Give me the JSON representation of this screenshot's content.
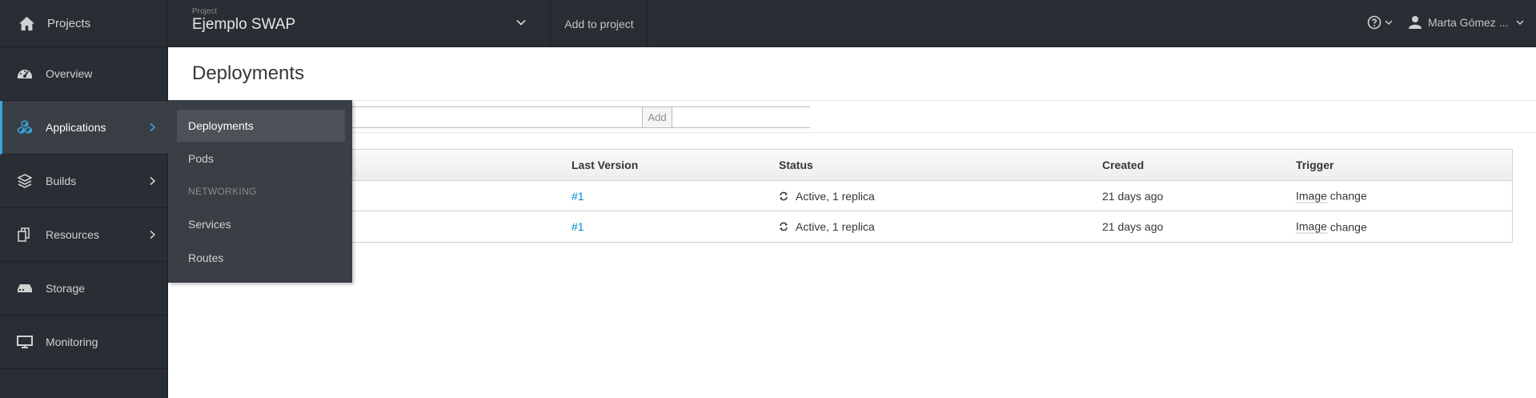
{
  "topbar": {
    "brand_label": "Projects",
    "project_caption": "Project",
    "project_name": "Ejemplo SWAP",
    "add_to_project": "Add to project",
    "user_name": "Marta Gómez ..."
  },
  "sidebar": {
    "items": [
      {
        "label": "Overview",
        "icon": "dashboard-icon"
      },
      {
        "label": "Applications",
        "icon": "cubes-icon",
        "active": true
      },
      {
        "label": "Builds",
        "icon": "layers-icon"
      },
      {
        "label": "Resources",
        "icon": "resources-icon"
      },
      {
        "label": "Storage",
        "icon": "storage-icon"
      },
      {
        "label": "Monitoring",
        "icon": "monitor-icon"
      }
    ]
  },
  "flyout": {
    "items": [
      "Deployments",
      "Pods"
    ],
    "section_header": "NETWORKING",
    "network_items": [
      "Services",
      "Routes"
    ]
  },
  "main": {
    "title": "Deployments",
    "filter_add": "Add",
    "columns": [
      "Last Version",
      "Status",
      "Created",
      "Trigger"
    ],
    "rows": [
      {
        "version": "#1",
        "status": "Active, 1 replica",
        "created": "21 days ago",
        "trigger_a": "Image",
        "trigger_b": " change"
      },
      {
        "version": "#1",
        "status": "Active, 1 replica",
        "created": "21 days ago",
        "trigger_a": "Image",
        "trigger_b": " change"
      }
    ]
  },
  "colors": {
    "nav_bg": "#292e34",
    "active_accent": "#39a5dc",
    "link": "#0088ce"
  }
}
